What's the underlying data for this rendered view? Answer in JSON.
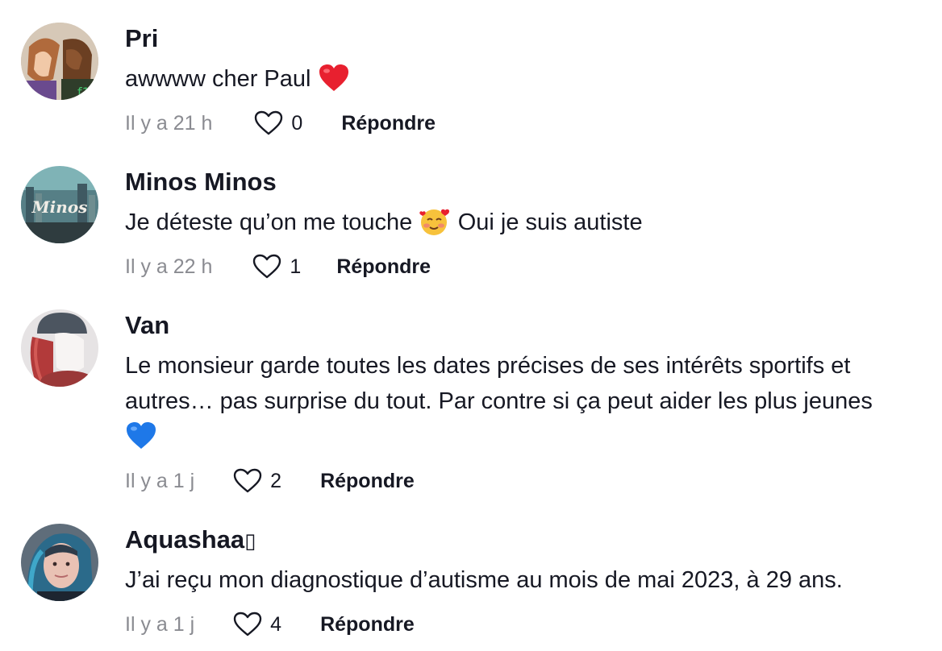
{
  "comments": [
    {
      "username": "Pri",
      "text": "awwww cher Paul",
      "emoji": "❤️",
      "time": "Il y a 21 h",
      "likes": "0",
      "reply_label": "Répondre",
      "icons": {
        "avatar": "avatar-pri",
        "like": "heart-outline-icon"
      }
    },
    {
      "username": "Minos Minos",
      "text_before": "Je déteste qu’on me touche",
      "emoji": "🥰",
      "text_after": "Oui je suis autiste",
      "time": "Il y a 22 h",
      "likes": "1",
      "reply_label": "Répondre"
    },
    {
      "username": "Van",
      "text": "Le monsieur garde toutes les dates précises de ses intérêts sportifs et autres… pas surprise du tout. Par contre si ça peut aider les plus jeunes",
      "emoji": "💙",
      "time": "Il y a 1 j",
      "likes": "2",
      "reply_label": "Répondre"
    },
    {
      "username": "Aquashaa",
      "username_suffix": "▯",
      "text": "J’ai reçu mon diagnostique d’autisme au mois de mai 2023, à 29 ans.",
      "time": "Il y a 1 j",
      "likes": "4",
      "reply_label": "Répondre"
    }
  ],
  "colors": {
    "text": "#161823",
    "muted": "#8a8b91",
    "background": "#ffffff",
    "heart_red": "#e8202f",
    "heart_blue": "#1e78e8"
  }
}
